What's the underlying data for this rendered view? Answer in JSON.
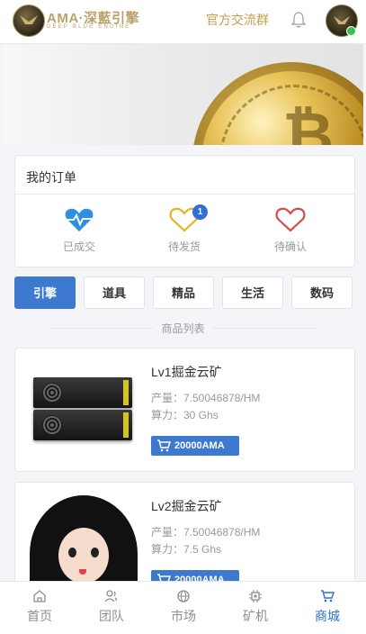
{
  "header": {
    "logo_title": "AMA·深藍引擎",
    "logo_subtitle": "DEEP BLUE ENGINE",
    "group_link": "官方交流群"
  },
  "orders": {
    "title": "我的订单",
    "items": [
      {
        "label": "已成交",
        "icon": "heartbeat-icon",
        "color": "#2f8fe0"
      },
      {
        "label": "待发货",
        "icon": "heart-outline-icon",
        "color": "#e6b422",
        "badge": "1"
      },
      {
        "label": "待确认",
        "icon": "heart-outline-icon",
        "color": "#d94a4a"
      }
    ]
  },
  "tabs": [
    {
      "label": "引擎",
      "active": true
    },
    {
      "label": "道具",
      "active": false
    },
    {
      "label": "精品",
      "active": false
    },
    {
      "label": "生活",
      "active": false
    },
    {
      "label": "数码",
      "active": false
    }
  ],
  "section_title": "商品列表",
  "products": [
    {
      "title": "Lv1掘金云矿",
      "output": "产量：7.50046878/HM",
      "power": "算力：30 Ghs",
      "price": "20000AMA"
    },
    {
      "title": "Lv2掘金云矿",
      "output": "产量：7.50046878/HM",
      "power": "算力：7.5 Ghs",
      "price": "20000AMA"
    }
  ],
  "nav": [
    {
      "label": "首页",
      "icon": "home-icon",
      "active": false
    },
    {
      "label": "团队",
      "icon": "team-icon",
      "active": false
    },
    {
      "label": "市场",
      "icon": "globe-icon",
      "active": false
    },
    {
      "label": "矿机",
      "icon": "chip-icon",
      "active": false
    },
    {
      "label": "商城",
      "icon": "cart-icon",
      "active": true
    }
  ],
  "colors": {
    "primary": "#3d79cf",
    "gold": "#c79e4c",
    "online": "#33c24a"
  }
}
